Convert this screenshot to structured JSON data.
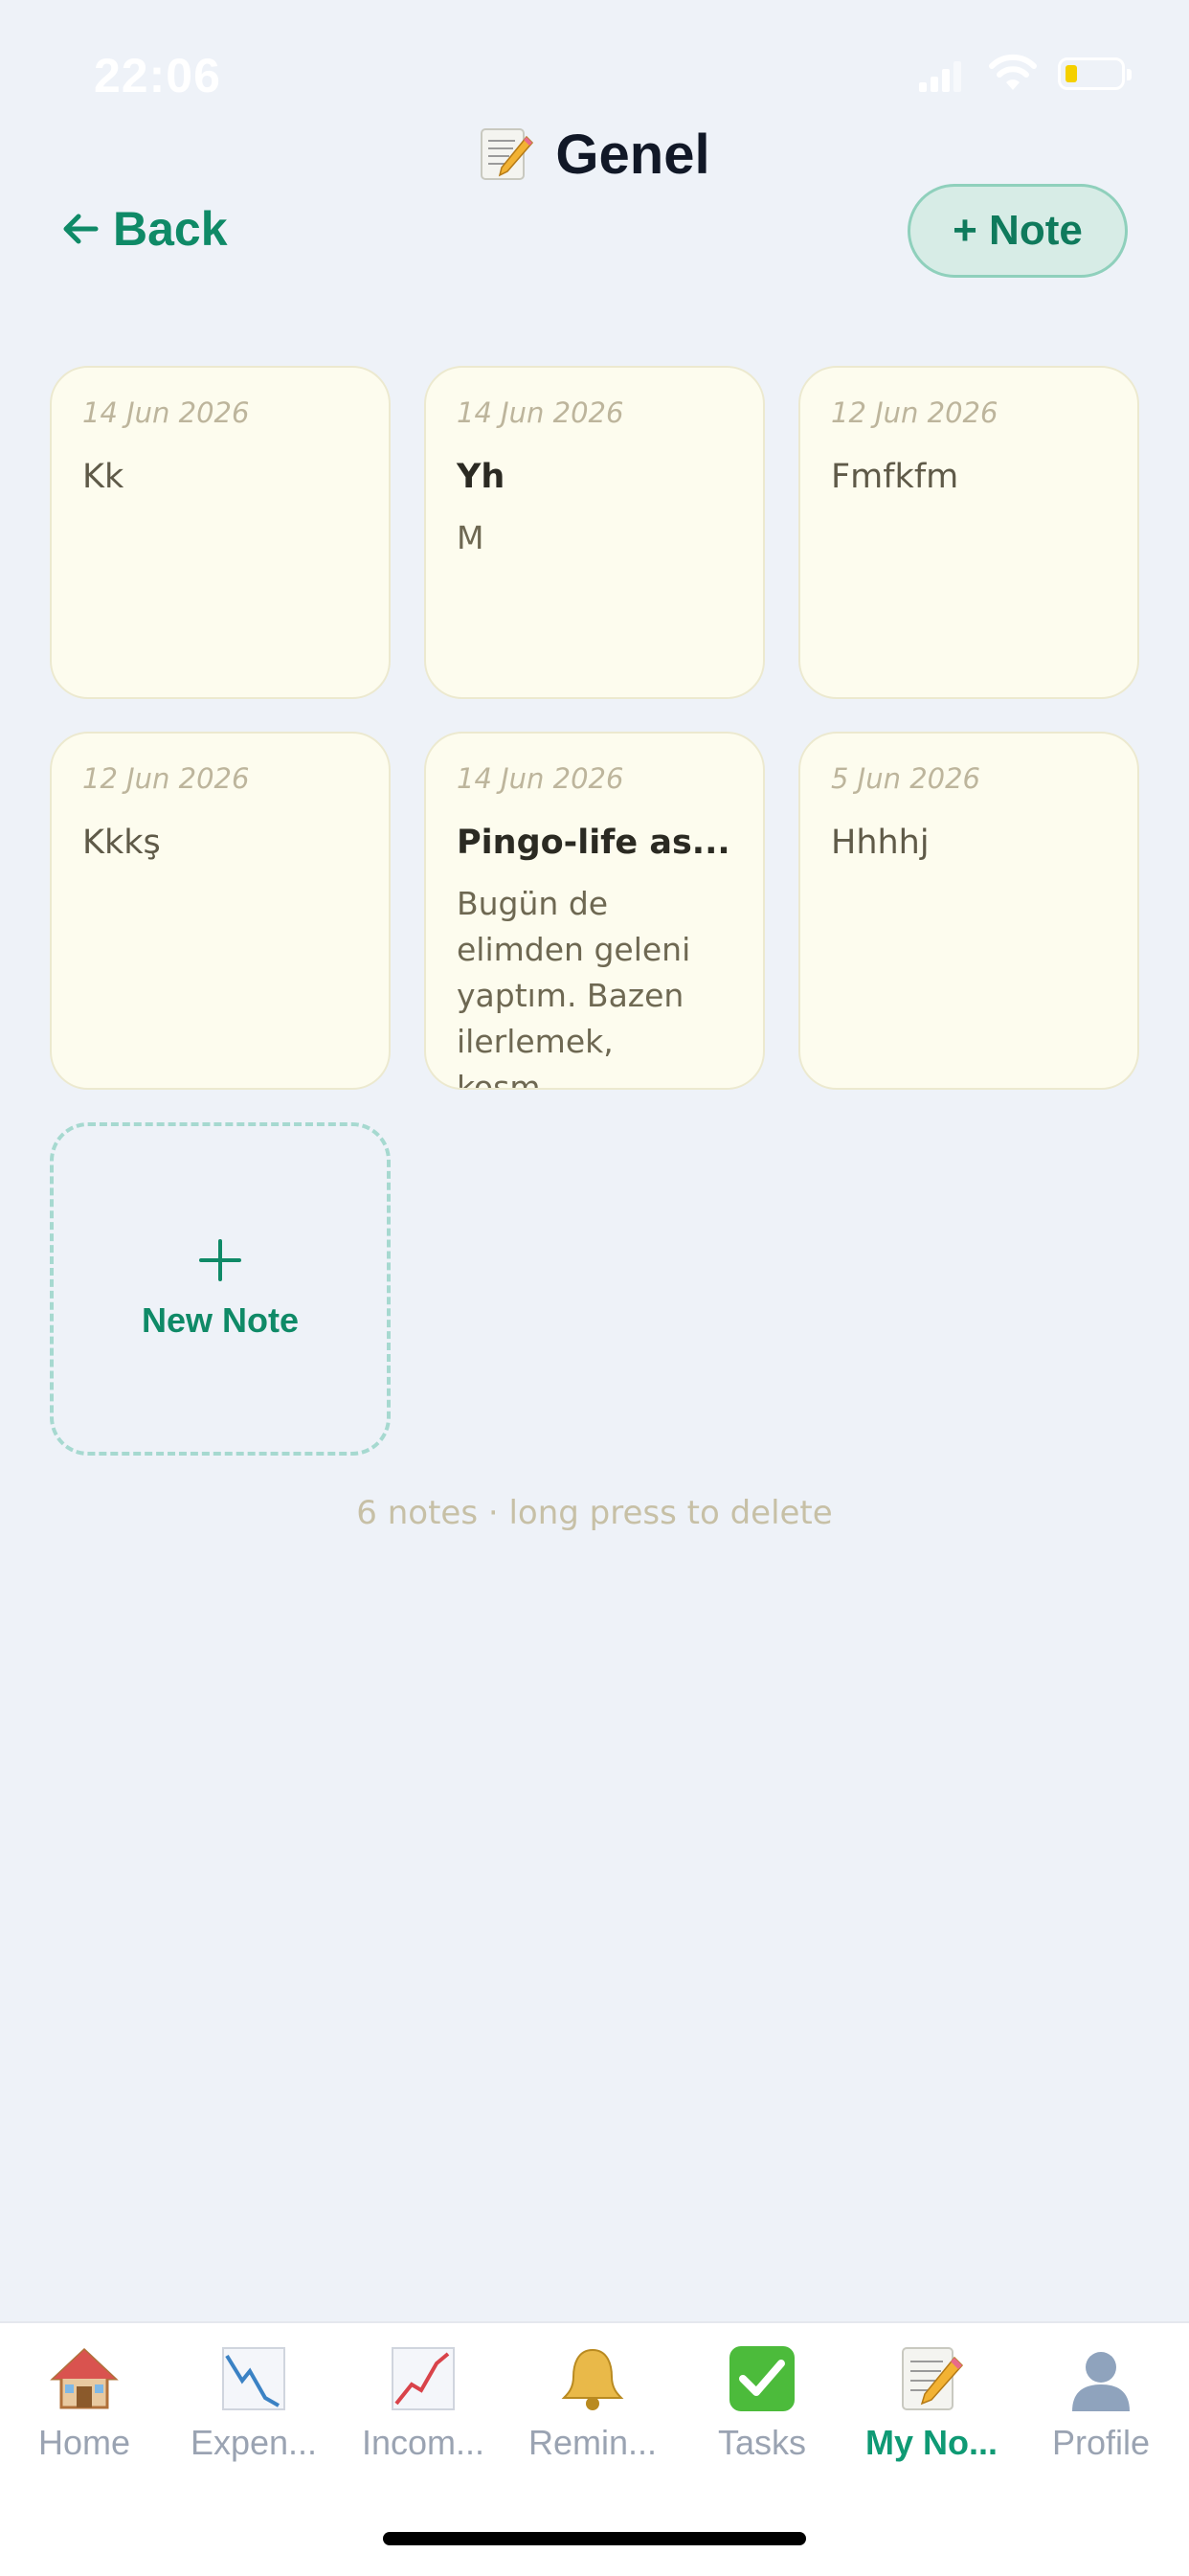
{
  "status_bar": {
    "time": "22:06"
  },
  "header": {
    "title": "Genel",
    "title_icon": "memo-icon",
    "back_label": "Back",
    "add_note_label": "+ Note"
  },
  "notes": [
    {
      "date": "14 Jun 2026",
      "title": "Kk",
      "body": ""
    },
    {
      "date": "14 Jun 2026",
      "title": "Yh",
      "body": "M"
    },
    {
      "date": "12 Jun 2026",
      "title": "Fmfkfm",
      "body": ""
    },
    {
      "date": "12 Jun 2026",
      "title": "Kkkş",
      "body": ""
    },
    {
      "date": "14 Jun 2026",
      "title": "Pingo-life as...",
      "body": "Bugün de elimden geleni yaptım. Bazen ilerlemek, koşm..."
    },
    {
      "date": "5 Jun 2026",
      "title": "Hhhhj",
      "body": ""
    }
  ],
  "new_note_label": "New Note",
  "hint": "6 notes · long press to delete",
  "tabs": [
    {
      "label": "Home",
      "icon": "house-icon"
    },
    {
      "label": "Expen...",
      "icon": "chart-decreasing-icon"
    },
    {
      "label": "Incom...",
      "icon": "chart-increasing-icon"
    },
    {
      "label": "Remin...",
      "icon": "bell-icon"
    },
    {
      "label": "Tasks",
      "icon": "check-box-icon"
    },
    {
      "label": "My No...",
      "icon": "memo-icon"
    },
    {
      "label": "Profile",
      "icon": "person-icon"
    }
  ],
  "active_tab": "My No...",
  "colors": {
    "accent": "#0f8a67",
    "card_bg": "#fdfcee",
    "page_bg": "#eef2f8"
  }
}
